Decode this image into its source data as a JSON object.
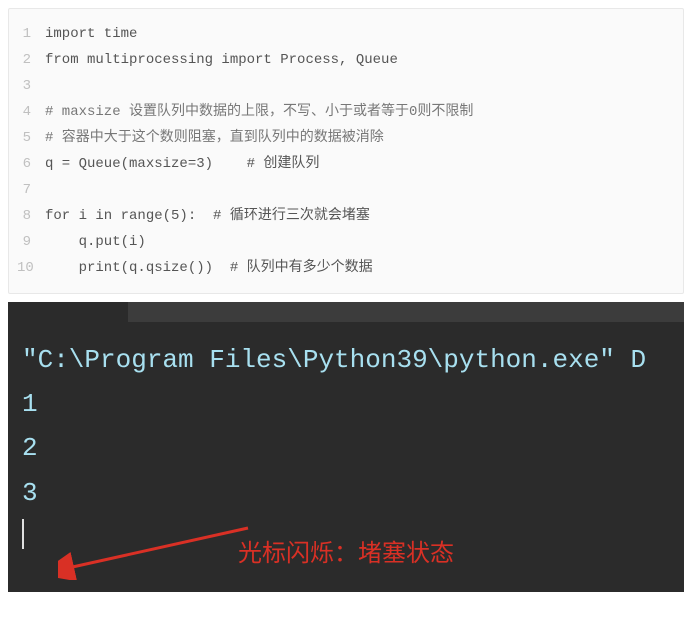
{
  "code": {
    "lines": [
      {
        "n": "1",
        "text": "import time"
      },
      {
        "n": "2",
        "text": "from multiprocessing import Process, Queue"
      },
      {
        "n": "3",
        "text": ""
      },
      {
        "n": "4",
        "text": "# maxsize 设置队列中数据的上限，不写、小于或者等于0则不限制"
      },
      {
        "n": "5",
        "text": "# 容器中大于这个数则阻塞，直到队列中的数据被消除"
      },
      {
        "n": "6",
        "text": "q = Queue(maxsize=3)    # 创建队列"
      },
      {
        "n": "7",
        "text": ""
      },
      {
        "n": "8",
        "text": "for i in range(5):  # 循环进行三次就会堵塞"
      },
      {
        "n": "9",
        "text": "    q.put(i)"
      },
      {
        "n": "10",
        "text": "    print(q.qsize())  # 队列中有多少个数据"
      }
    ]
  },
  "terminal": {
    "command": "\"C:\\Program Files\\Python39\\python.exe\" D",
    "output": [
      "1",
      "2",
      "3"
    ]
  },
  "annotation": {
    "text": "光标闪烁：堵塞状态"
  }
}
